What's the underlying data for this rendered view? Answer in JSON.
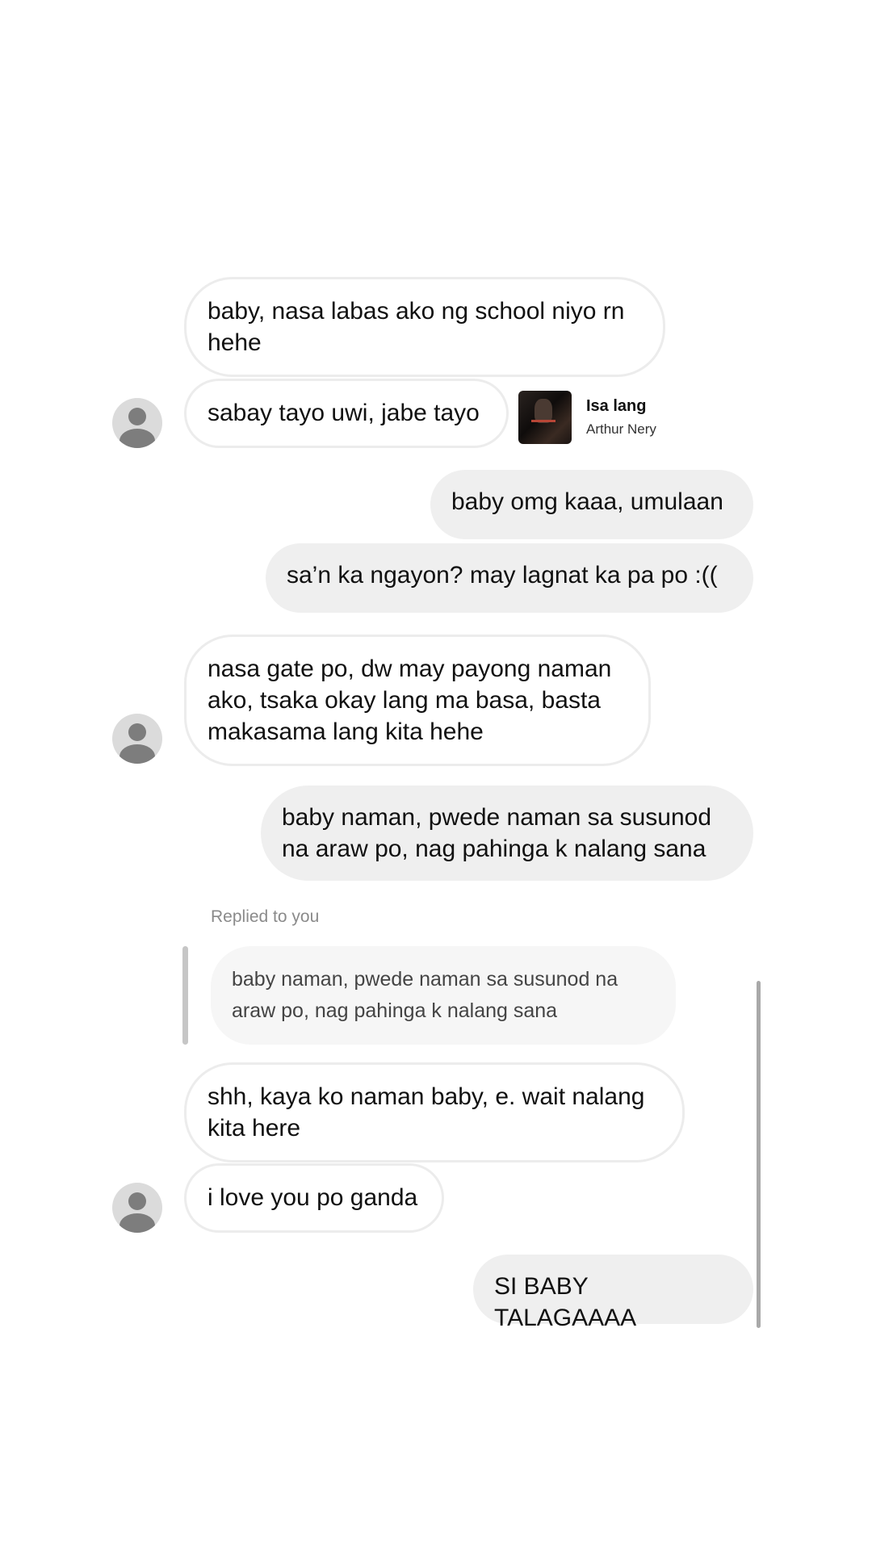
{
  "messages": [
    {
      "id": "m1",
      "direction": "incoming",
      "text": "baby, nasa labas ako ng school niyo rn hehe"
    },
    {
      "id": "m2",
      "direction": "incoming",
      "text": "sabay tayo uwi, jabe tayo"
    },
    {
      "id": "m3",
      "direction": "outgoing",
      "text": "baby omg kaaa, umulaan"
    },
    {
      "id": "m4",
      "direction": "outgoing",
      "text": "sa’n ka ngayon? may lagnat ka pa po :(("
    },
    {
      "id": "m5",
      "direction": "incoming",
      "text": "nasa gate po, dw may payong naman ako, tsaka okay lang ma basa, basta makasama lang kita hehe"
    },
    {
      "id": "m6",
      "direction": "outgoing",
      "text": "baby naman, pwede naman sa susunod na araw po, nag pahinga k nalang sana"
    },
    {
      "id": "m7",
      "direction": "incoming",
      "text": "shh, kaya ko naman baby, e. wait nalang kita here"
    },
    {
      "id": "m8",
      "direction": "incoming",
      "text": "i love you po ganda"
    },
    {
      "id": "m9",
      "direction": "outgoing",
      "text": "SI BABY TALAGAAAA"
    }
  ],
  "music": {
    "title": "Isa lang",
    "artist": "Arthur Nery",
    "icon": "album-art-thumbnail"
  },
  "reply": {
    "label": "Replied to you",
    "quoted_text": "baby naman, pwede naman sa susunod na araw po, nag pahinga k nalang sana"
  },
  "colors": {
    "incoming_bubble_bg": "#ffffff",
    "incoming_bubble_border": "#ececec",
    "outgoing_bubble_bg": "#efefef",
    "avatar_bg": "#dbdbdb",
    "avatar_fg": "#7d7d7d"
  }
}
